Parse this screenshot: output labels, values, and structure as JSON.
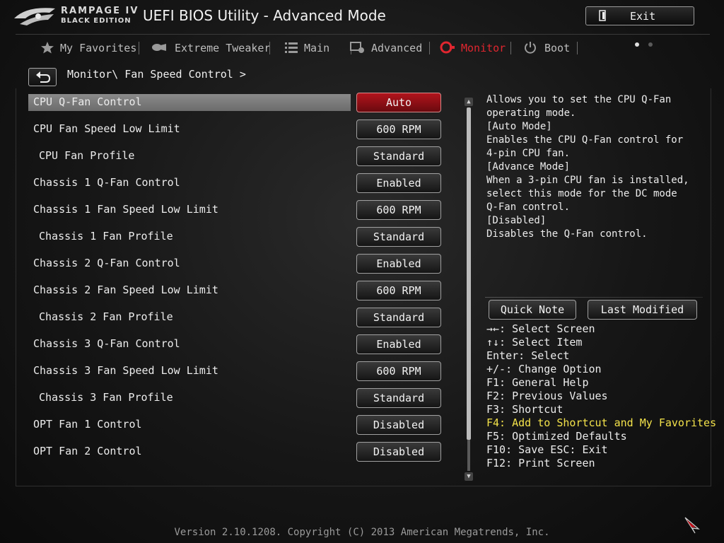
{
  "header": {
    "logo_line1": "RAMPAGE IV",
    "logo_line2": "BLACK EDITION",
    "title": "UEFI BIOS Utility - Advanced Mode",
    "exit_label": "Exit"
  },
  "tabs": [
    {
      "label": "My Favorites",
      "icon": "star-icon"
    },
    {
      "label": "Extreme Tweaker",
      "icon": "tweaker-icon"
    },
    {
      "label": "Main",
      "icon": "list-icon"
    },
    {
      "label": "Advanced",
      "icon": "advanced-icon"
    },
    {
      "label": "Monitor",
      "icon": "monitor-icon",
      "active": true
    },
    {
      "label": "Boot",
      "icon": "power-icon"
    }
  ],
  "breadcrumb": "Monitor\\ Fan Speed Control >",
  "settings": [
    {
      "label": "CPU Q-Fan Control",
      "value": "Auto"
    },
    {
      "label": "CPU Fan Speed Low Limit",
      "value": "600 RPM"
    },
    {
      "label": "CPU Fan Profile",
      "value": "Standard"
    },
    {
      "label": "Chassis 1 Q-Fan Control",
      "value": "Enabled"
    },
    {
      "label": "Chassis 1 Fan Speed Low Limit",
      "value": "600 RPM"
    },
    {
      "label": "Chassis 1 Fan Profile",
      "value": "Standard"
    },
    {
      "label": "Chassis 2 Q-Fan Control",
      "value": "Enabled"
    },
    {
      "label": "Chassis 2 Fan Speed Low Limit",
      "value": "600 RPM"
    },
    {
      "label": "Chassis 2 Fan Profile",
      "value": "Standard"
    },
    {
      "label": "Chassis 3 Q-Fan Control",
      "value": "Enabled"
    },
    {
      "label": "Chassis 3 Fan Speed Low Limit",
      "value": "600 RPM"
    },
    {
      "label": "Chassis 3 Fan Profile",
      "value": "Standard"
    },
    {
      "label": "OPT Fan 1 Control",
      "value": "Disabled"
    },
    {
      "label": "OPT Fan 2 Control",
      "value": "Disabled"
    }
  ],
  "help": {
    "lines": [
      "Allows you to set the CPU Q-Fan",
      "operating mode.",
      "[Auto Mode]",
      "Enables the CPU Q-Fan control for",
      "4-pin CPU fan.",
      "[Advance Mode]",
      "When a 3-pin CPU fan is installed,",
      "select this mode for the DC mode",
      "Q-Fan control.",
      "[Disabled]",
      "Disables the Q-Fan control."
    ],
    "quick_note": "Quick Note",
    "last_modified": "Last Modified"
  },
  "keys": [
    "→←: Select Screen",
    "↑↓: Select Item",
    "Enter: Select",
    "+/-: Change Option",
    "F1: General Help",
    "F2: Previous Values",
    "F3: Shortcut",
    "F4: Add to Shortcut and My Favorites",
    "F5: Optimized Defaults",
    "F10: Save  ESC: Exit",
    "F12: Print Screen"
  ],
  "footer": "Version 2.10.1208. Copyright (C) 2013 American Megatrends, Inc.",
  "colors": {
    "accent": "#e0262f",
    "highlight_key": "#f3e24a"
  }
}
